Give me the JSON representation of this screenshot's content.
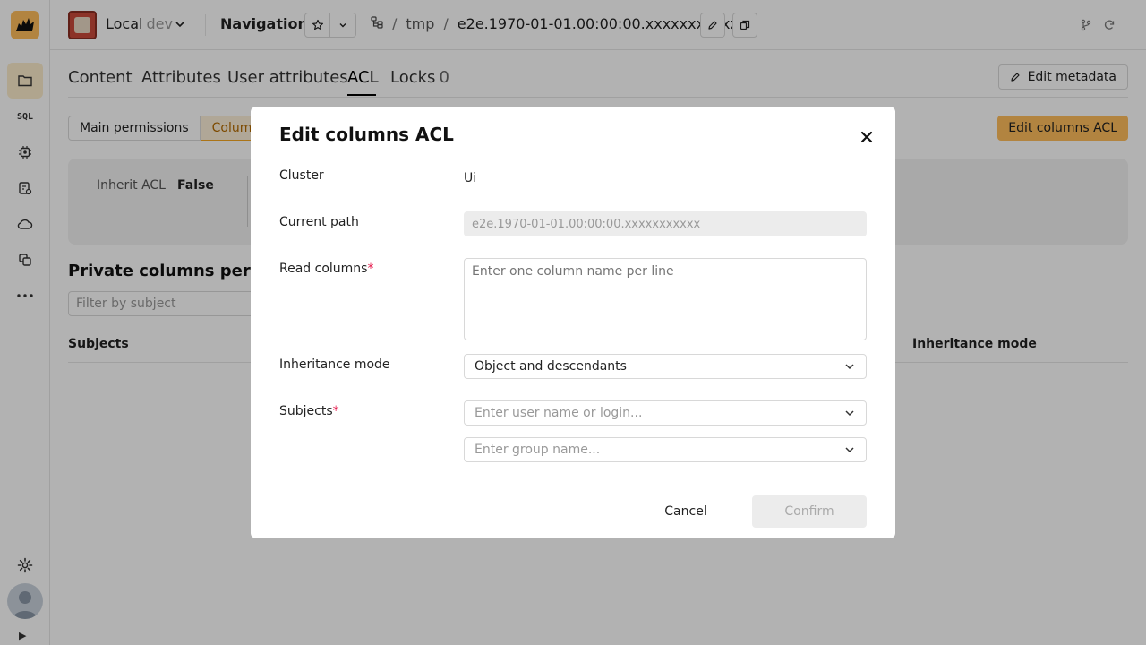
{
  "sidebar": {
    "items": [
      {
        "icon": "folder-icon",
        "active": true
      },
      {
        "label": "SQL"
      },
      {
        "icon": "chip-icon"
      },
      {
        "icon": "operations-icon"
      },
      {
        "icon": "cloud-icon"
      },
      {
        "icon": "dashboard-icon"
      },
      {
        "icon": "more-icon"
      }
    ],
    "settings_icon": "gear-icon",
    "expand_glyph": "▶"
  },
  "header": {
    "cluster_name": "Local",
    "cluster_env": "dev",
    "page_title": "Navigation",
    "breadcrumbs": [
      "tmp",
      "e2e.1970-01-01.00:00:00.xxxxxxxxxxx"
    ],
    "separator": "/"
  },
  "tabs": [
    {
      "label": "Content"
    },
    {
      "label": "Attributes"
    },
    {
      "label": "User attributes"
    },
    {
      "label": "ACL",
      "active": true
    },
    {
      "label": "Locks",
      "count": "0"
    }
  ],
  "toolbar": {
    "edit_metadata": "Edit metadata",
    "edit_columns_acl": "Edit columns ACL"
  },
  "acl": {
    "segments": [
      "Main permissions",
      "Column g"
    ],
    "inherit_label": "Inherit ACL",
    "inherit_value": "False",
    "section_title": "Private columns permis",
    "filter_placeholder": "Filter by subject",
    "col_subjects": "Subjects",
    "col_inheritance": "Inheritance mode"
  },
  "modal": {
    "title": "Edit columns ACL",
    "cluster_label": "Cluster",
    "cluster_value": "Ui",
    "path_label": "Current path",
    "path_value": "e2e.1970-01-01.00:00:00.xxxxxxxxxxx",
    "read_columns_label": "Read columns",
    "read_columns_placeholder": "Enter one column name per line",
    "required_mark": "*",
    "inheritance_label": "Inheritance mode",
    "inheritance_value": "Object and descendants",
    "subjects_label": "Subjects",
    "user_placeholder": "Enter user name or login...",
    "group_placeholder": "Enter group name...",
    "cancel": "Cancel",
    "confirm": "Confirm"
  },
  "colors": {
    "accent": "#ffbe5c",
    "accent_light": "#fdeccc",
    "required": "#e5174a",
    "overlay": "rgba(0,0,0,0.3)"
  }
}
